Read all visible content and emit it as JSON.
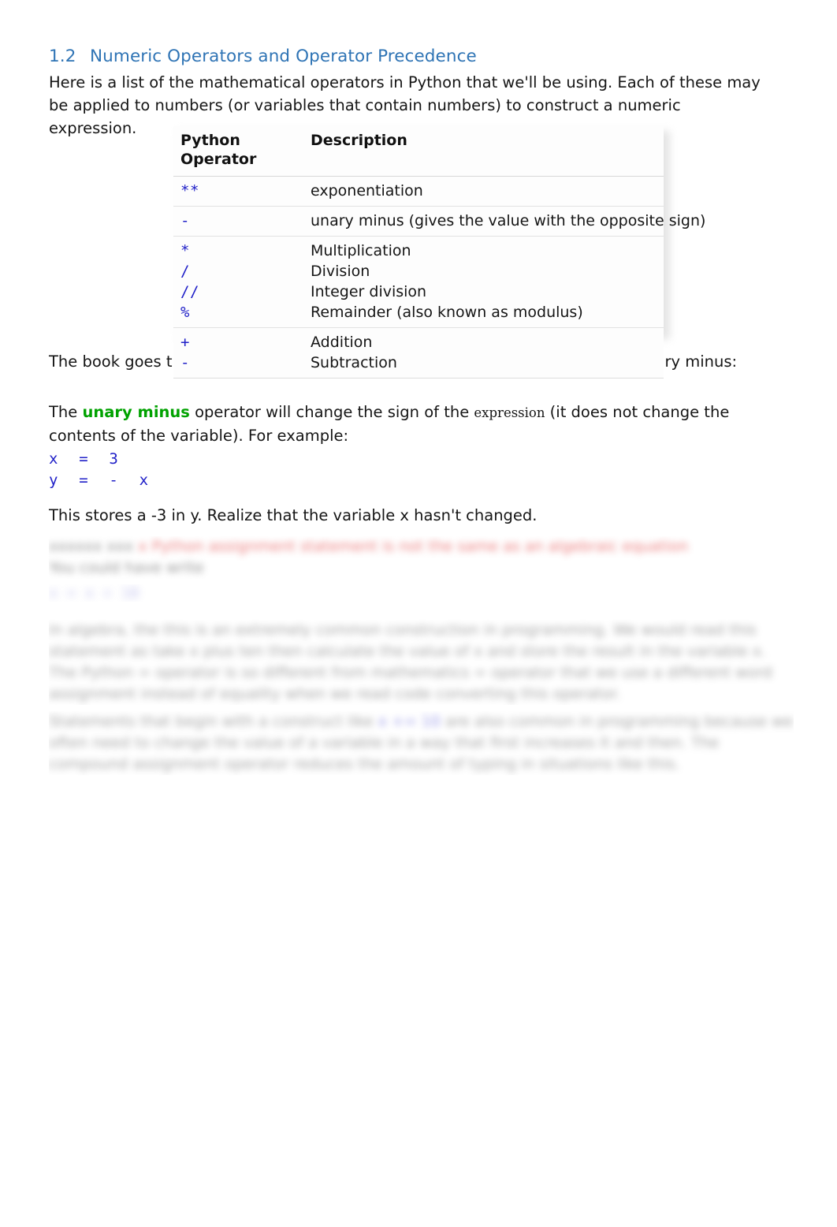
{
  "document": {
    "heading": {
      "number": "1.2",
      "title": "Numeric Operators and Operator Precedence",
      "color": "#2f74b5"
    },
    "intro_paragraph": "Here is a list of the mathematical operators in Python that we'll be using. Each of these may be applied to numbers (or variables that contain numbers) to construct a numeric expression.",
    "operators_table": {
      "headers": [
        "Python Operator",
        "Description"
      ],
      "rows": [
        {
          "operators": [
            "**"
          ],
          "descriptions": [
            "exponentiation"
          ]
        },
        {
          "operators": [
            "-"
          ],
          "descriptions": [
            "unary minus (gives the value with the opposite sign)"
          ]
        },
        {
          "operators": [
            "*",
            "/",
            "//",
            "%"
          ],
          "descriptions": [
            "Multiplication",
            "Division",
            "Integer division",
            "Remainder (also known as modulus)"
          ]
        },
        {
          "operators": [
            "+",
            "-"
          ],
          "descriptions": [
            "Addition",
            "Subtraction"
          ]
        }
      ],
      "operator_color": "#2020c8"
    },
    "book_paragraph": "The book goes through these operators well, but seems to have missed the unary minus:",
    "unary_paragraph": {
      "before": "The ",
      "highlight": "unary minus",
      "highlight_color": "#00a200",
      "middle": " operator will change the sign of the ",
      "small_word": "expression",
      "after": "  (it does not change the contents of the variable). For example:"
    },
    "code_example": {
      "line1": "x  =  3",
      "line2": "y  =  -  x",
      "color": "#2020c8"
    },
    "stores_paragraph": "This stores a -3 in y. Realize that the variable x hasn't changed.",
    "blurred_region": {
      "note": "illegible blurred text",
      "line1_gray": "xxxxxx xxx ",
      "line1_red": "x Python assignment statement is not the same as an algebraic equation",
      "line2_gray": "You could have write",
      "code_line": "x = x + 10",
      "paragraph1": "In algebra, the this is an extremely common construction in programming. We would read this statement as take x plus ten then calculate the value of x and store the result in the variable x. The Python = operator is so different from mathematics = operator that we use a different word assignment instead of equality when we read code converting this operator.",
      "paragraph2": "Statements that begin with a construct like this are also common in programming because we often need to change the value of a variable in a way that first increases it and then. The compound assignment operator reduces the amount of typing in situations like this.",
      "paragraph2_blue_segment": "x += 10"
    }
  }
}
